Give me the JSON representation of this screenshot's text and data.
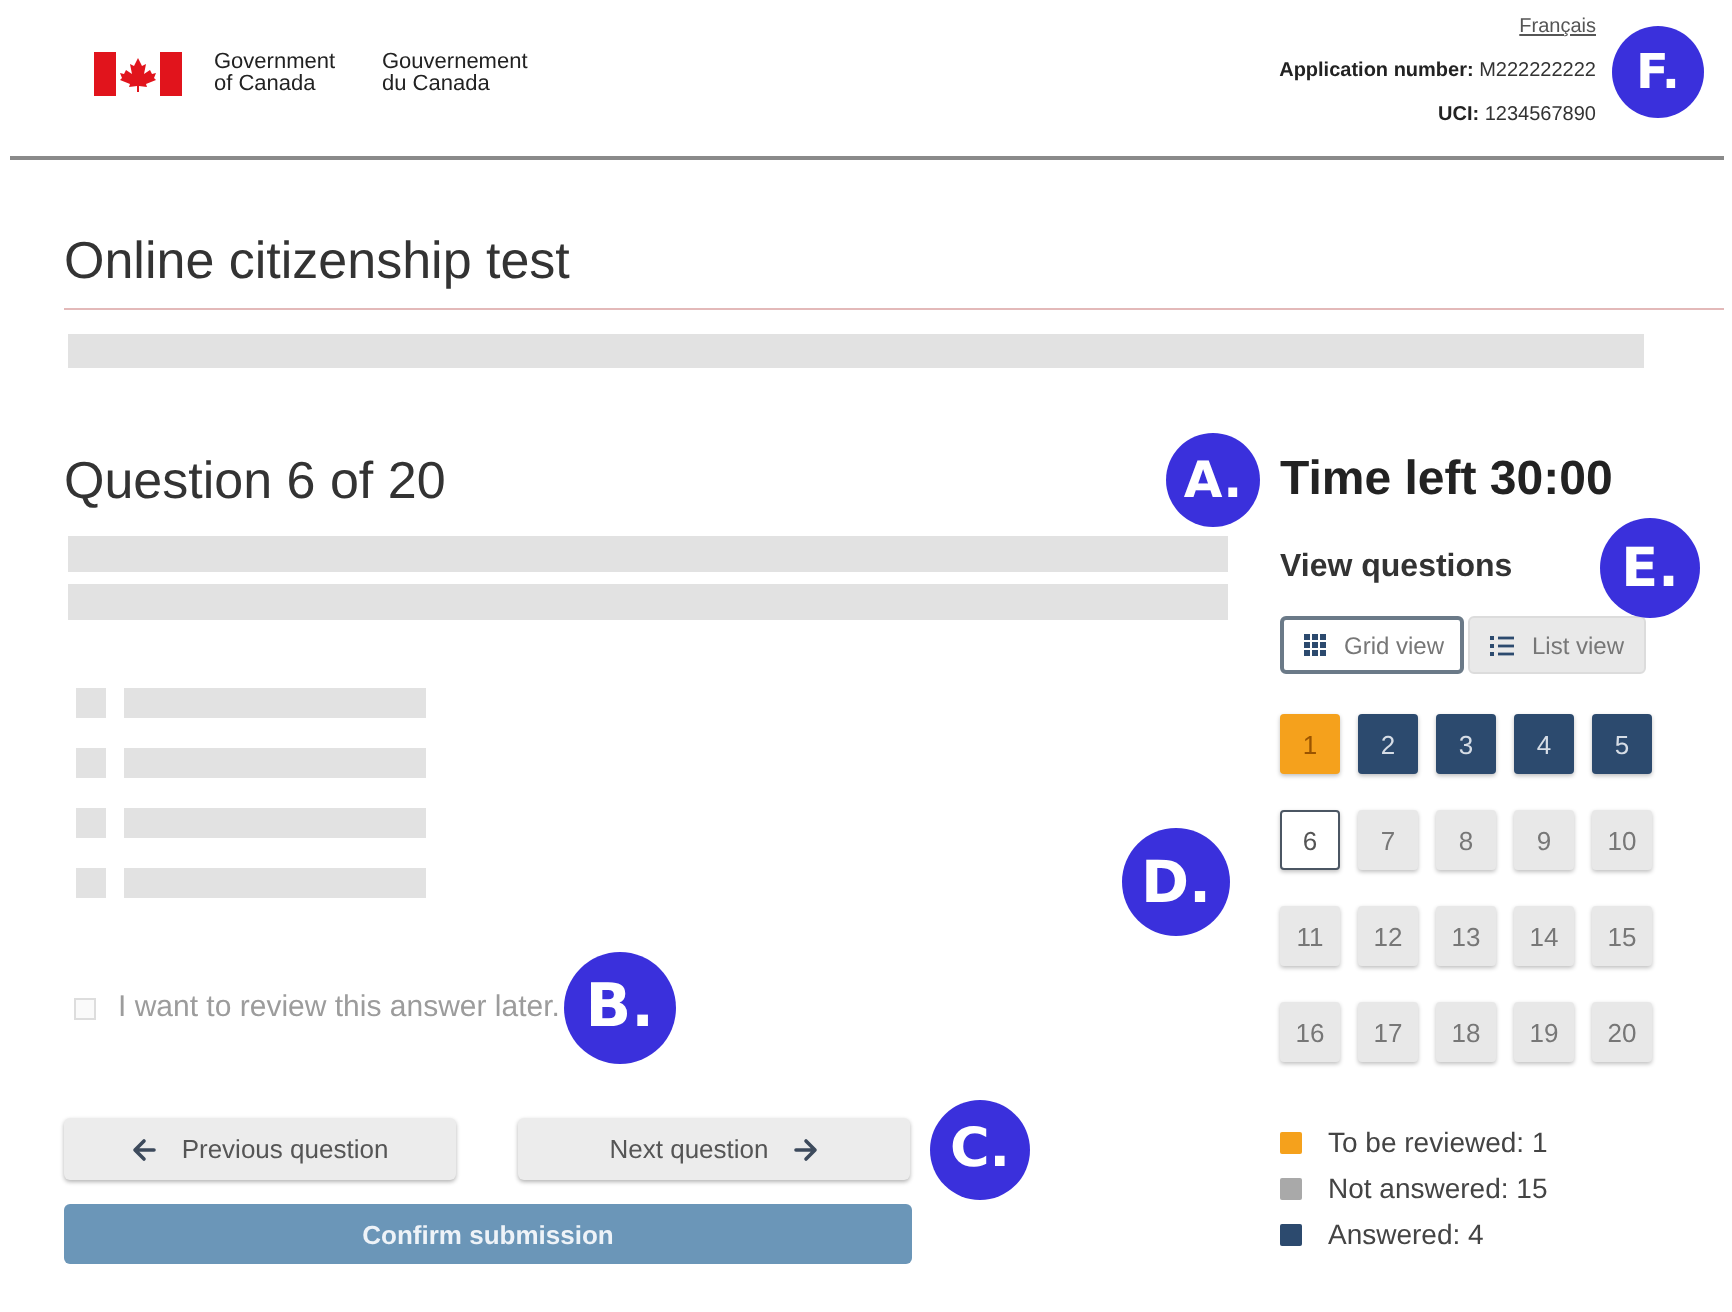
{
  "header": {
    "wordmarks": [
      "Government\nof Canada",
      "Gouvernement\ndu Canada"
    ],
    "language_link": "Français",
    "application_number": "**Application number:** M222222222",
    "uci": "**UCI:** 1234567890",
    "marker": "F."
  },
  "page_title": "Online citizenship test",
  "question": {
    "heading": "Question 6 of 20",
    "options": [
      {
        "selected": false
      },
      {
        "selected": false
      },
      {
        "selected": false
      },
      {
        "selected": false
      }
    ],
    "review_later": {
      "label": "I want to review this answer later.",
      "checked": false,
      "marker": "B."
    }
  },
  "navigation": {
    "previous": "Previous question",
    "next": "Next question",
    "marker": "C.",
    "confirm": "Confirm submission"
  },
  "sidebar": {
    "timer": "Time left 30:00",
    "timer_marker": "A.",
    "view_questions": "View questions",
    "view_marker": "E.",
    "views": [
      {
        "kind": "grid",
        "label": "Grid view",
        "selected": true
      },
      {
        "kind": "list",
        "label": "List view",
        "selected": false
      }
    ],
    "question_grid": {
      "marker": "D.",
      "items": [
        {
          "number": "1",
          "kind": "review",
          "selected": false
        },
        {
          "number": "2",
          "kind": "answered",
          "selected": false
        },
        {
          "number": "3",
          "kind": "answered",
          "selected": false
        },
        {
          "number": "4",
          "kind": "answered",
          "selected": false
        },
        {
          "number": "5",
          "kind": "answered",
          "selected": false
        },
        {
          "number": "6",
          "kind": "unanswered",
          "selected": true
        },
        {
          "number": "7",
          "kind": "unanswered",
          "selected": false
        },
        {
          "number": "8",
          "kind": "unanswered",
          "selected": false
        },
        {
          "number": "9",
          "kind": "unanswered",
          "selected": false
        },
        {
          "number": "10",
          "kind": "unanswered",
          "selected": false
        },
        {
          "number": "11",
          "kind": "unanswered",
          "selected": false
        },
        {
          "number": "12",
          "kind": "unanswered",
          "selected": false
        },
        {
          "number": "13",
          "kind": "unanswered",
          "selected": false
        },
        {
          "number": "14",
          "kind": "unanswered",
          "selected": false
        },
        {
          "number": "15",
          "kind": "unanswered",
          "selected": false
        },
        {
          "number": "16",
          "kind": "unanswered",
          "selected": false
        },
        {
          "number": "17",
          "kind": "unanswered",
          "selected": false
        },
        {
          "number": "18",
          "kind": "unanswered",
          "selected": false
        },
        {
          "number": "19",
          "kind": "unanswered",
          "selected": false
        },
        {
          "number": "20",
          "kind": "unanswered",
          "selected": false
        }
      ]
    },
    "legend": [
      {
        "label": "To be reviewed: 1",
        "color": "#f5a11c"
      },
      {
        "label": "Not answered: 15",
        "color": "#a9a9a9"
      },
      {
        "label": "Answered: 4",
        "color": "#2c4a6e"
      }
    ]
  }
}
